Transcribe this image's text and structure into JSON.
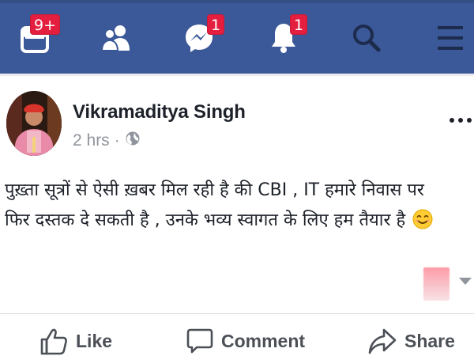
{
  "nav": {
    "items": [
      {
        "name": "news-feed",
        "icon": "news-feed-icon",
        "badge": "9+"
      },
      {
        "name": "friends",
        "icon": "friends-icon",
        "badge": ""
      },
      {
        "name": "messenger",
        "icon": "messenger-icon",
        "badge": "1"
      },
      {
        "name": "notifications",
        "icon": "bell-icon",
        "badge": "1"
      },
      {
        "name": "search",
        "icon": "search-icon",
        "badge": ""
      },
      {
        "name": "menu",
        "icon": "hamburger-menu-icon",
        "badge": ""
      }
    ],
    "bar_color": "#3b5998",
    "badge_color": "#e41e3f"
  },
  "post": {
    "author": "Vikramaditya Singh",
    "time": "2 hrs",
    "separator": "·",
    "privacy_icon": "globe-icon",
    "more_icon": "more-options-icon",
    "text_line1": "पुख़्ता सूत्रों से ऐसी ख़बर मिल रही है की CBI , IT हमारे निवास पर",
    "text_line2": "फिर दस्तक दे सकती है , उनके भव्य स्वागत के लिए हम तैयार है",
    "emoji": "smiling-face-emoji"
  },
  "actions": {
    "like": "Like",
    "comment": "Comment",
    "share": "Share"
  }
}
